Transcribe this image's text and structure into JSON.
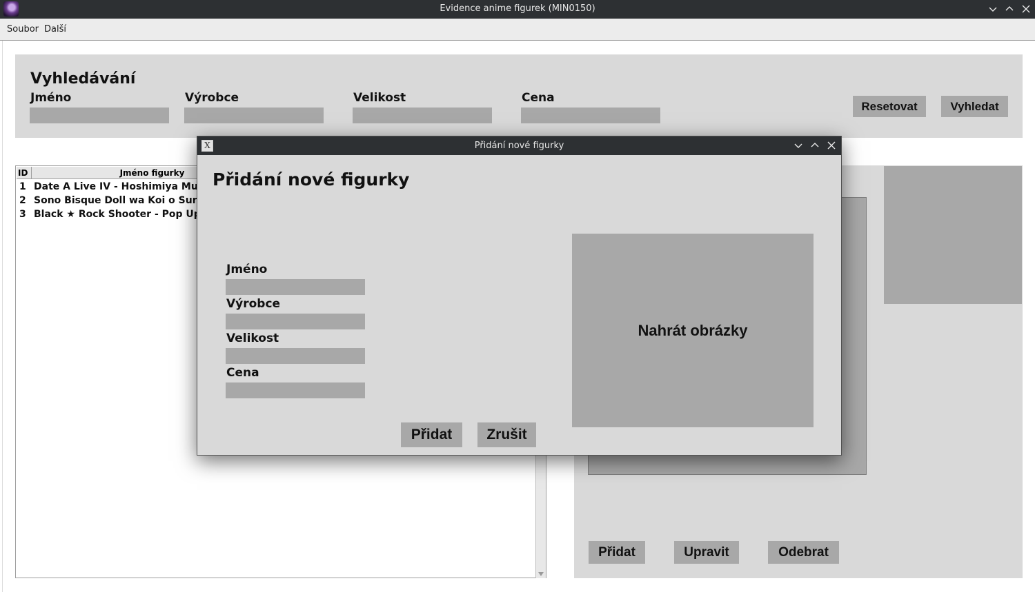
{
  "window": {
    "title": "Evidence anime figurek (MIN0150)"
  },
  "menu": {
    "items": [
      "Soubor",
      "Další"
    ]
  },
  "search": {
    "heading": "Vyhledávání",
    "fields": [
      {
        "label": "Jméno",
        "value": ""
      },
      {
        "label": "Výrobce",
        "value": ""
      },
      {
        "label": "Velikost",
        "value": ""
      },
      {
        "label": "Cena",
        "value": ""
      }
    ],
    "reset_label": "Resetovat",
    "search_label": "Vyhledat"
  },
  "table": {
    "columns": [
      "ID",
      "Jméno figurky"
    ],
    "rows": [
      {
        "id": "1",
        "name": "Date A Live IV - Hoshimiya Mukuro"
      },
      {
        "id": "2",
        "name": "Sono Bisque Doll wa Koi o Suru - Kitagawa Marin"
      },
      {
        "id": "3",
        "name": "Black ★ Rock Shooter - Pop Up Parade"
      }
    ]
  },
  "actions": {
    "add_label": "Přidat",
    "edit_label": "Upravit",
    "remove_label": "Odebrat"
  },
  "dialog": {
    "window_title": "Přidání nové figurky",
    "heading": "Přidání nové figurky",
    "fields": [
      {
        "label": "Jméno",
        "value": ""
      },
      {
        "label": "Výrobce",
        "value": ""
      },
      {
        "label": "Velikost",
        "value": ""
      },
      {
        "label": "Cena",
        "value": ""
      }
    ],
    "upload_label": "Nahrát obrázky",
    "add_label": "Přidat",
    "cancel_label": "Zrušit"
  }
}
